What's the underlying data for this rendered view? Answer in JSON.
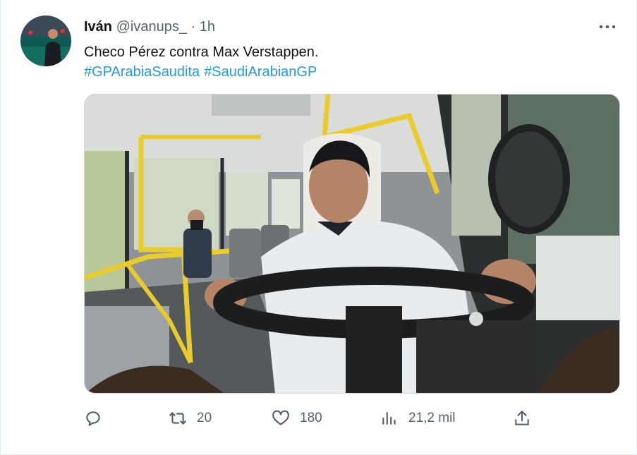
{
  "user": {
    "name": "Iván",
    "handle": "@ivanups_",
    "separator": "·",
    "time": "1h"
  },
  "tweet": {
    "text": "Checo Pérez contra Max Verstappen.",
    "hashtags": [
      "#GPArabiaSaudita",
      "#SaudiArabianGP"
    ]
  },
  "actions": {
    "reply_count": "",
    "retweet_count": "20",
    "like_count": "180",
    "views_count": "21,2 mil"
  },
  "colors": {
    "link": "#1d9bf0",
    "muted": "#536471",
    "yellow_rail": "#e9cc2c"
  },
  "icons": [
    "more-icon",
    "reply-icon",
    "retweet-icon",
    "like-icon",
    "views-icon",
    "share-icon"
  ]
}
